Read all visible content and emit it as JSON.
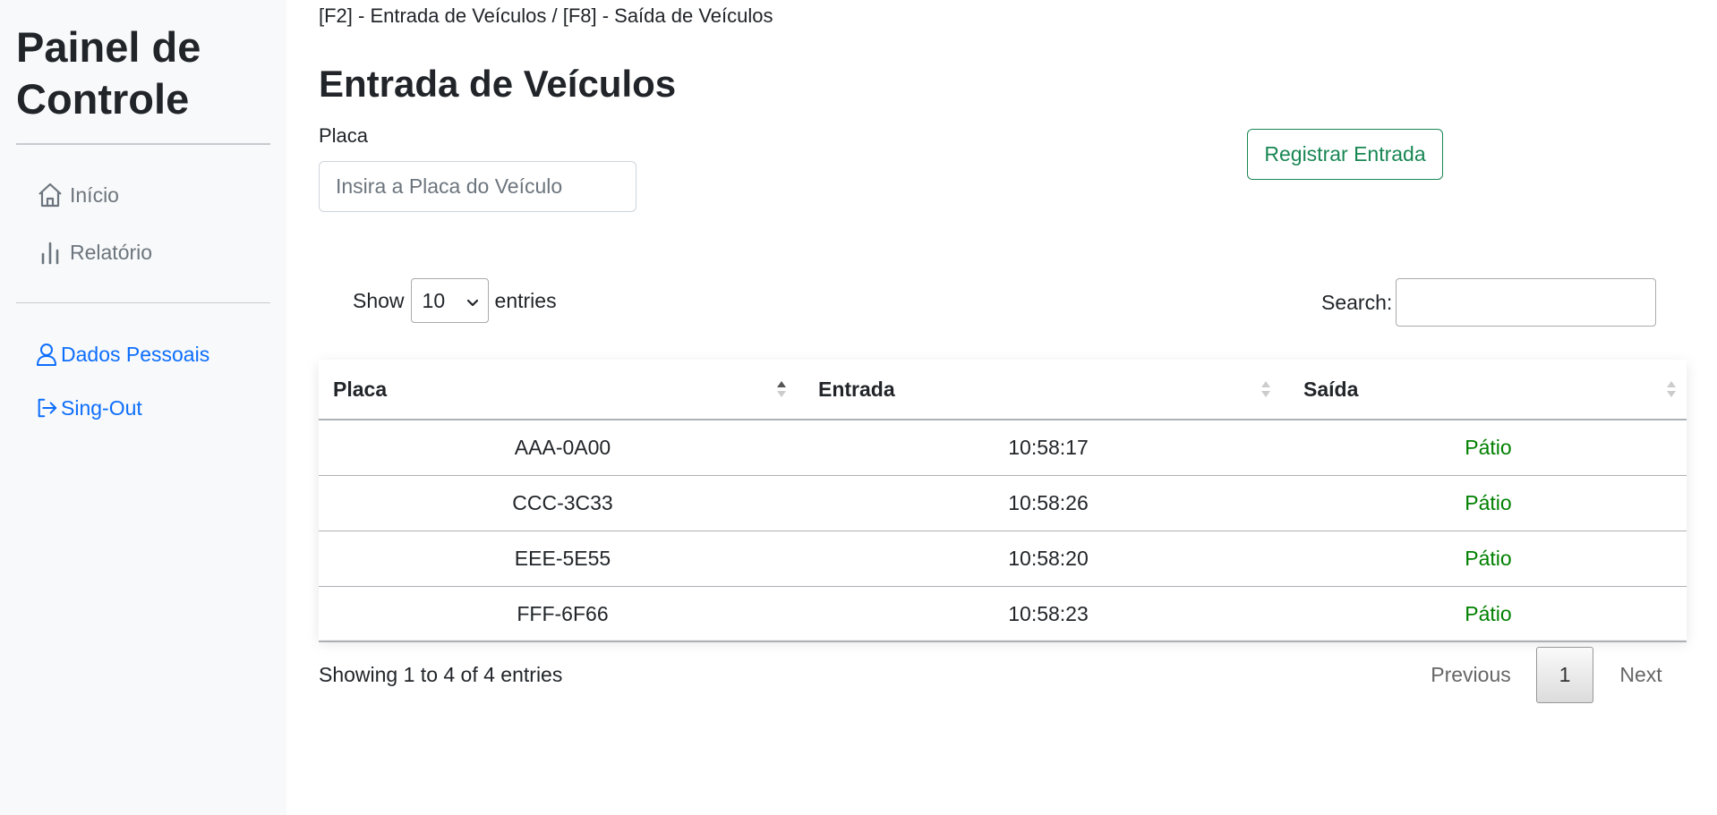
{
  "sidebar": {
    "brand": "Painel de Controle",
    "nav": [
      {
        "label": "Início",
        "icon": "house-icon"
      },
      {
        "label": "Relatório",
        "icon": "bar-chart-icon"
      }
    ],
    "account": [
      {
        "label": "Dados Pessoais",
        "icon": "person-icon"
      },
      {
        "label": "Sing-Out",
        "icon": "sign-out-icon"
      }
    ]
  },
  "main": {
    "breadcrumb": "[F2] - Entrada de Veículos / [F8] - Saída de Veículos",
    "title": "Entrada de Veículos",
    "placa_label": "Placa",
    "placa_placeholder": "Insira a Placa do Veículo",
    "register_button": "Registrar Entrada"
  },
  "datatable": {
    "show_label": "Show",
    "entries_label": "entries",
    "page_length": "10",
    "search_label": "Search:",
    "columns": [
      "Placa",
      "Entrada",
      "Saída"
    ],
    "rows": [
      {
        "placa": "AAA-0A00",
        "entrada": "10:58:17",
        "saida": "Pátio"
      },
      {
        "placa": "CCC-3C33",
        "entrada": "10:58:26",
        "saida": "Pátio"
      },
      {
        "placa": "EEE-5E55",
        "entrada": "10:58:20",
        "saida": "Pátio"
      },
      {
        "placa": "FFF-6F66",
        "entrada": "10:58:23",
        "saida": "Pátio"
      }
    ],
    "info": "Showing 1 to 4 of 4 entries",
    "pagination": {
      "previous": "Previous",
      "current": "1",
      "next": "Next"
    }
  },
  "colors": {
    "sidebar_bg": "#f8f9fa",
    "link_blue": "#0d6efd",
    "success_green": "#198754",
    "status_green": "#008000"
  }
}
